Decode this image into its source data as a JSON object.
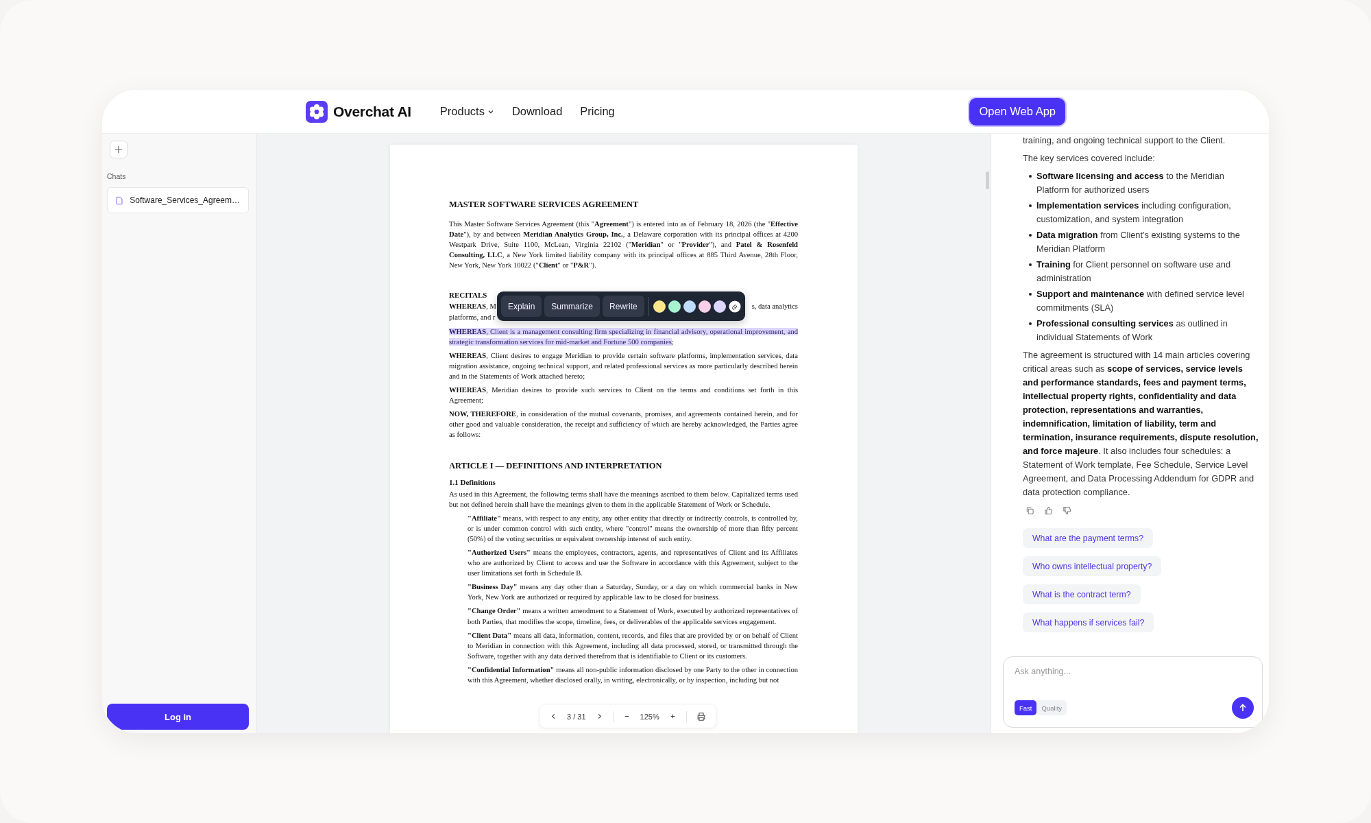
{
  "header": {
    "brand": "Overchat AI",
    "nav": [
      {
        "label": "Products",
        "has_menu": true
      },
      {
        "label": "Download",
        "has_menu": false
      },
      {
        "label": "Pricing",
        "has_menu": false
      }
    ],
    "cta": "Open Web App"
  },
  "sidebar": {
    "section_label": "Chats",
    "chats": [
      {
        "title": "Software_Services_Agreem…",
        "selected": true
      }
    ],
    "login": "Log in"
  },
  "document": {
    "blocks": [
      {
        "kind": "title",
        "text": "MASTER SOFTWARE SERVICES AGREEMENT"
      },
      {
        "kind": "paragraph",
        "text": "This Master Software Services Agreement (this \"**Agreement**\") is entered into as of February 18, 2026 (the \"**Effective Date**\"), by and between **Meridian Analytics Group, Inc.**, a Delaware corporation with its principal offices at 4200 Westpark Drive, Suite 1100, McLean, Virginia 22102 (\"**Meridian**\" or \"**Provider**\"), and **Patel & Rosenfeld Consulting, LLC**, a New York limited liability company with its principal offices at 885 Third Avenue, 28th Floor, New York, New York 10022 (\"**Client**\" or \"**P&R**\")."
      },
      {
        "kind": "heading",
        "text": "RECITALS"
      },
      {
        "kind": "covered",
        "left": "**WHEREAS**, M",
        "right": "s, data analytics",
        "second_line": "platforms, and r"
      },
      {
        "kind": "paragraph",
        "selected_text": "**WHEREAS**, Client is a management consulting firm specializing in financial advisory, operational improvement, and strategic transformation services for mid-market and Fortune 500 companies",
        "text": ";"
      },
      {
        "kind": "paragraph",
        "text": "**WHEREAS**, Client desires to engage Meridian to provide certain software platforms, implementation services, data migration assistance, ongoing technical support, and related professional services as more particularly described herein and in the Statements of Work attached hereto;"
      },
      {
        "kind": "paragraph",
        "text": "**WHEREAS**, Meridian desires to provide such services to Client on the terms and conditions set forth in this Agreement;"
      },
      {
        "kind": "paragraph",
        "text": "**NOW, THEREFORE**, in consideration of the mutual covenants, promises, and agreements contained herein, and for other good and valuable consideration, the receipt and sufficiency of which are hereby acknowledged, the Parties agree as follows:"
      },
      {
        "kind": "article",
        "text": "ARTICLE I — DEFINITIONS AND INTERPRETATION"
      },
      {
        "kind": "subheading",
        "text": "1.1 Definitions"
      },
      {
        "kind": "paragraph",
        "text": "As used in this Agreement, the following terms shall have the meanings ascribed to them below. Capitalized terms used but not defined herein shall have the meanings given to them in the applicable Statement of Work or Schedule."
      },
      {
        "kind": "definition",
        "text": "**\"Affiliate\"** means, with respect to any entity, any other entity that directly or indirectly controls, is controlled by, or is under common control with such entity, where \"control\" means the ownership of more than fifty percent (50%) of the voting securities or equivalent ownership interest of such entity."
      },
      {
        "kind": "definition",
        "text": "**\"Authorized Users\"** means the employees, contractors, agents, and representatives of Client and its Affiliates who are authorized by Client to access and use the Software in accordance with this Agreement, subject to the user limitations set forth in Schedule B."
      },
      {
        "kind": "definition",
        "text": "**\"Business Day\"** means any day other than a Saturday, Sunday, or a day on which commercial banks in New York, New York are authorized or required by applicable law to be closed for business."
      },
      {
        "kind": "definition",
        "text": "**\"Change Order\"** means a written amendment to a Statement of Work, executed by authorized representatives of both Parties, that modifies the scope, timeline, fees, or deliverables of the applicable services engagement."
      },
      {
        "kind": "definition",
        "text": "**\"Client Data\"** means all data, information, content, records, and files that are provided by or on behalf of Client to Meridian in connection with this Agreement, including all data processed, stored, or transmitted through the Software, together with any data derived therefrom that is identifiable to Client or its customers."
      },
      {
        "kind": "definition",
        "text": "**\"Confidential Information\"** means all non-public information disclosed by one Party to the other in connection with this Agreement, whether disclosed orally, in writing, electronically, or by inspection, including but not"
      }
    ],
    "selection_toolbar": {
      "actions": [
        "Explain",
        "Summarize",
        "Rewrite"
      ],
      "highlight_colors": [
        {
          "color": "#fde68a"
        },
        {
          "color": "#a7f3d0"
        },
        {
          "color": "#bfdbfe"
        },
        {
          "color": "#fbcfe8"
        },
        {
          "color": "#ddd6fe"
        }
      ]
    },
    "pager": {
      "page": "3 / 31",
      "zoom": "125%"
    }
  },
  "chat": {
    "messages": [
      {
        "kind": "paragraph",
        "text": "training, and ongoing technical support to the Client."
      },
      {
        "kind": "paragraph",
        "text": "The key services covered include:"
      },
      {
        "kind": "bullets",
        "items": [
          "**Software licensing and access** to the Meridian Platform for authorized users",
          "**Implementation services** including configuration, customization, and system integration",
          "**Data migration** from Client's existing systems to the Meridian Platform",
          "**Training** for Client personnel on software use and administration",
          "**Support and maintenance** with defined service level commitments (SLA)",
          "**Professional consulting services** as outlined in individual Statements of Work"
        ]
      },
      {
        "kind": "paragraph",
        "text": "The agreement is structured with 14 main articles covering critical areas such as **scope of services, service levels and performance standards, fees and payment terms, intellectual property rights, confidentiality and data protection, representations and warranties, indemnification, limitation of liability, term and termination, insurance requirements, dispute resolution, and force majeure**. It also includes four schedules: a Statement of Work template, Fee Schedule, Service Level Agreement, and Data Processing Addendum for GDPR and data protection compliance."
      }
    ],
    "suggestions": [
      "What are the payment terms?",
      "Who owns intellectual property?",
      "What is the contract term?",
      "What happens if services fail?"
    ],
    "input": {
      "placeholder": "Ask anything..."
    },
    "modes": [
      {
        "label": "Fast",
        "selected": true
      },
      {
        "label": "Quality",
        "selected": false
      }
    ]
  }
}
